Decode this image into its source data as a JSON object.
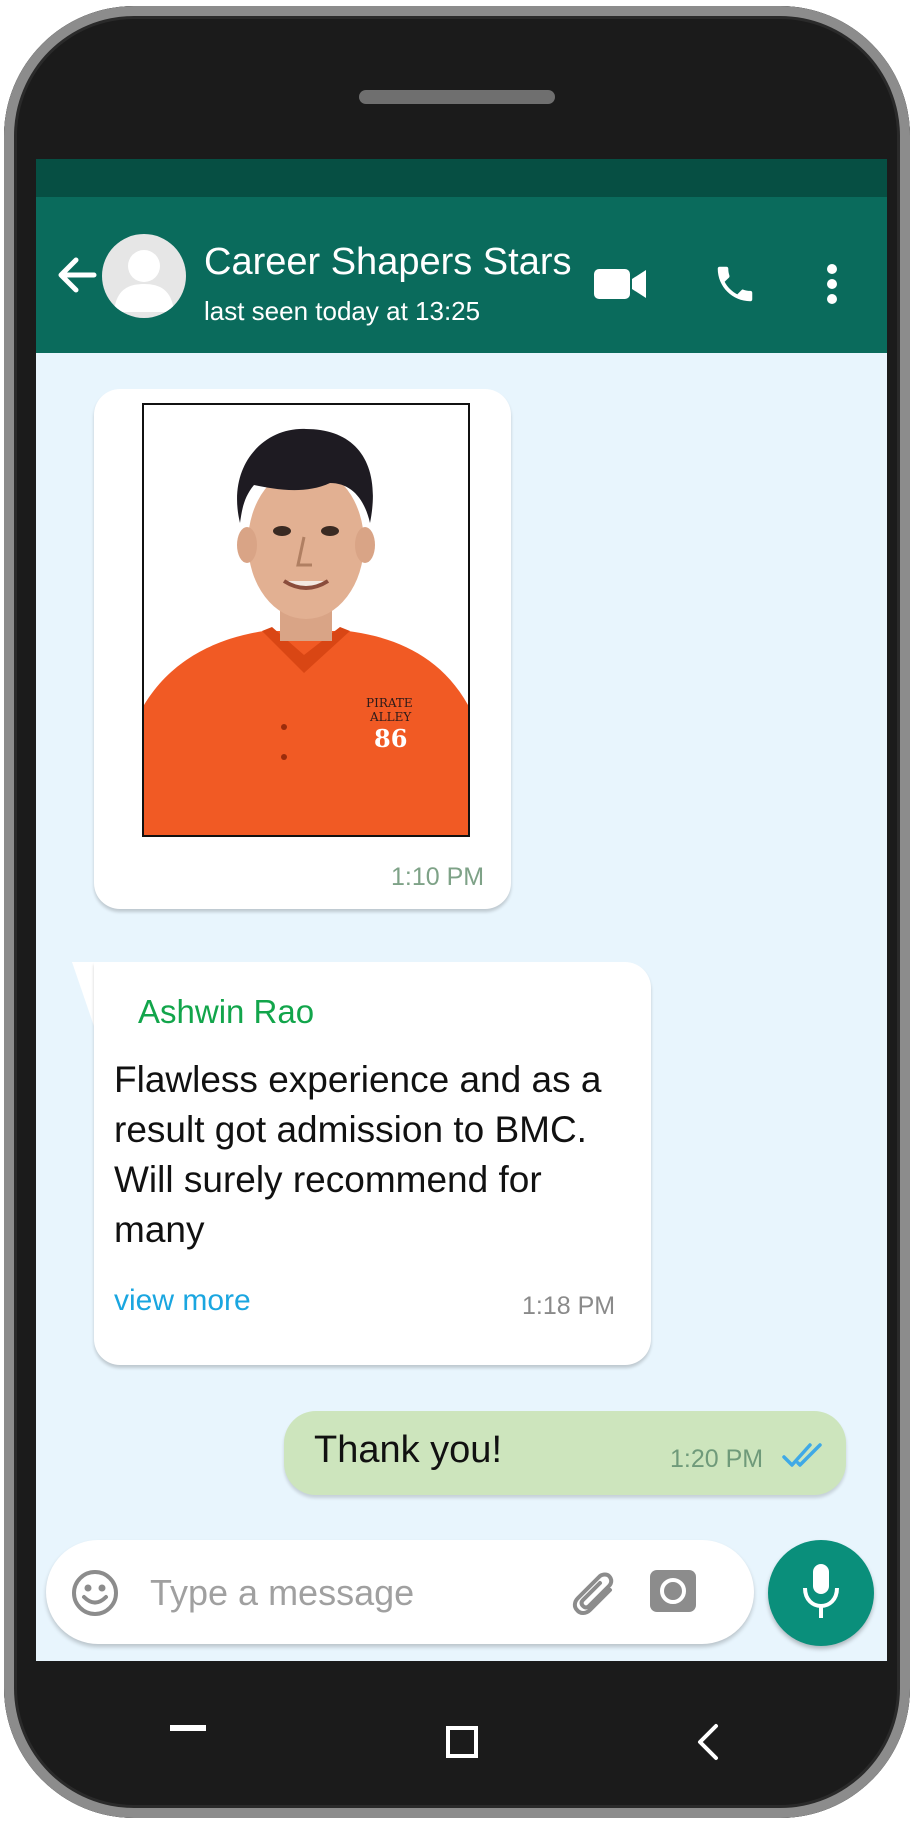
{
  "header": {
    "title": "Career Shapers Stars",
    "status": "last seen today at 13:25"
  },
  "messages": [
    {
      "type": "image",
      "time": "1:10 PM",
      "shirt_text_line1": "PIRATE",
      "shirt_text_line2": "ALLEY",
      "shirt_number": "86"
    },
    {
      "type": "text",
      "sender": "Ashwin Rao",
      "text": "Flawless experience and as a result got admission to BMC. Will surely recommend for many",
      "link": "view more",
      "time": "1:18 PM"
    },
    {
      "type": "sent",
      "text": "Thank you!",
      "time": "1:20 PM"
    }
  ],
  "composer": {
    "placeholder": "Type a message"
  },
  "colors": {
    "header": "#0a6b5c",
    "status_bar": "#064f43",
    "chat_bg": "#e8f5fd",
    "sent_bubble": "#cde5bd",
    "sender_name": "#12a54b",
    "link": "#1aa6e0",
    "mic_button": "#0a8f7b"
  }
}
